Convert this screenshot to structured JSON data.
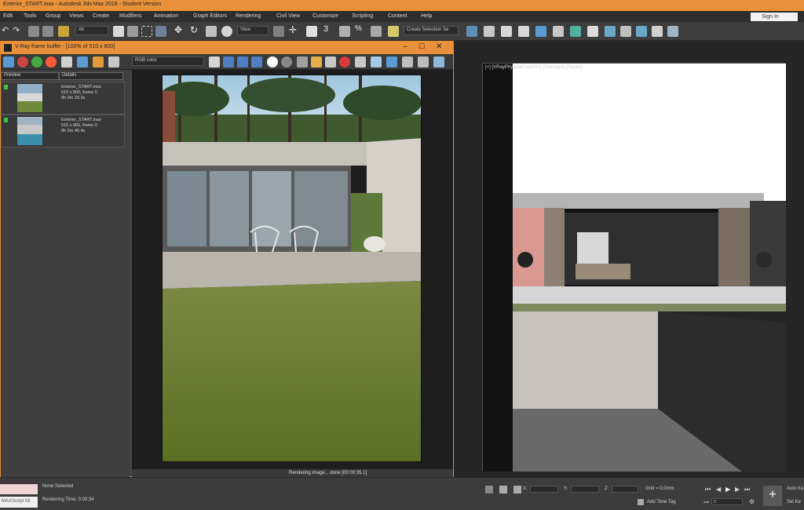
{
  "window": {
    "title": "Exterior_START.max - Autodesk 3ds Max 2018 - Student Version"
  },
  "menu": [
    "Edit",
    "Tools",
    "Group",
    "Views",
    "Create",
    "Modifiers",
    "Animation",
    "Graph Editors",
    "Rendering",
    "Civil View",
    "Customize",
    "Scripting",
    "Content",
    "Help"
  ],
  "signin": "Sign In",
  "toolbar": {
    "filter_value": "All",
    "view_value": "View",
    "selection_set": "Create Selection Se"
  },
  "vfb": {
    "title": "V-Ray frame buffer - [100% of 510 x 800]",
    "channel_value": "RGB color",
    "history_headers": [
      "Preview",
      "Details"
    ],
    "history": [
      {
        "details": [
          "Exterior_START.max",
          "510 x 800, frame 0",
          "0h 0m 33.2s"
        ]
      },
      {
        "details": [
          "Exterior_START.max",
          "510 x 800, frame 0",
          "0h 0m 40.4s"
        ]
      }
    ],
    "status_text": "Rendering image... done [00:00:35.1]"
  },
  "viewport": {
    "label": "[+] [VRayPhysicalCam001] [Standard] [Facets]"
  },
  "status": {
    "selection": "None Selected",
    "render_time": "Rendering Time: 0:00:34",
    "maxscript": "MAXScript Mi",
    "grid": "Grid = 0.0mm",
    "add_time_tag": "Add Time Tag",
    "x_label": "X:",
    "y_label": "Y:",
    "z_label": "Z:",
    "auto_key": "Auto Ke",
    "set_key": "Set Ke",
    "frame": "0"
  },
  "colors": {
    "accent": "#e9913a",
    "panel": "#3c3c3c",
    "history_marker": "#3ec34a"
  }
}
